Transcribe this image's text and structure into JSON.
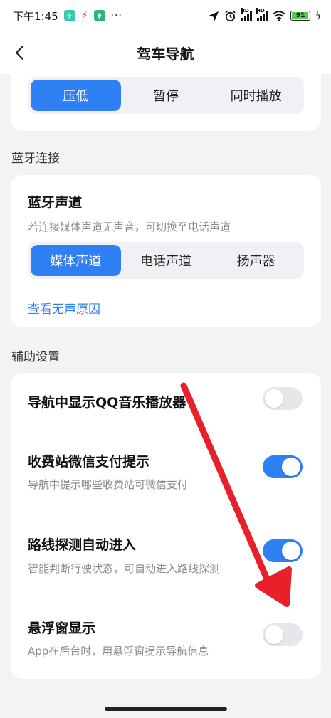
{
  "status_bar": {
    "time": "下午1:45",
    "battery": "91",
    "hd1": "HD",
    "hd2": "HD"
  },
  "header": {
    "title": "驾车导航"
  },
  "voice_mode": {
    "options": [
      "压低",
      "暂停",
      "同时播放"
    ],
    "selected": 0
  },
  "bluetooth_section": {
    "label": "蓝牙连接",
    "channel_title": "蓝牙声道",
    "channel_desc": "若连接媒体声道无声音，可切换至电话声道",
    "options": [
      "媒体声道",
      "电话声道",
      "扬声器"
    ],
    "selected": 0,
    "link": "查看无声原因"
  },
  "assist_section": {
    "label": "辅助设置",
    "items": [
      {
        "title": "导航中显示QQ音乐播放器",
        "desc": "",
        "on": false
      },
      {
        "title": "收费站微信支付提示",
        "desc": "导航中提示哪些收费站可微信支付",
        "on": true
      },
      {
        "title": "路线探测自动进入",
        "desc": "智能判断行驶状态，可自动进入路线探测",
        "on": true
      },
      {
        "title": "悬浮窗显示",
        "desc": "App在后台时，用悬浮窗提示导航信息",
        "on": false
      }
    ]
  },
  "colors": {
    "accent": "#2f7ff5",
    "annotation_arrow": "#e8202a"
  }
}
